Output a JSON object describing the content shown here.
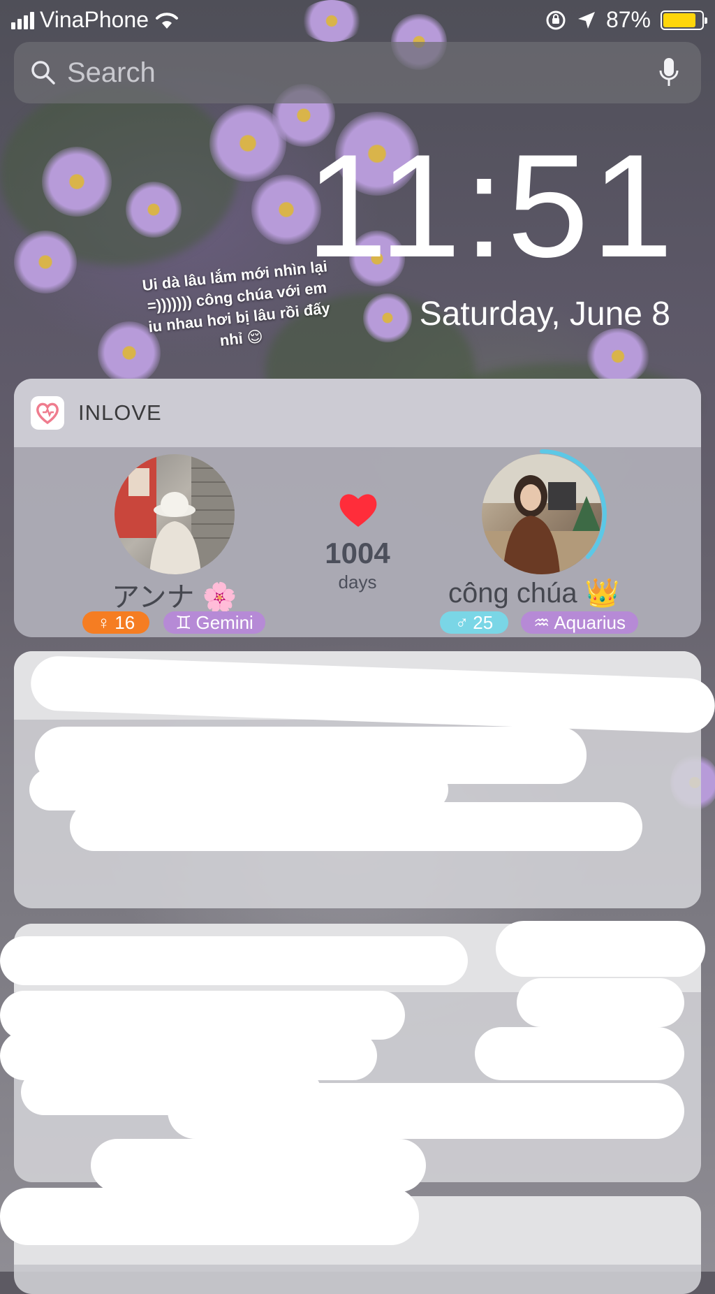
{
  "status_bar": {
    "carrier": "VinaPhone",
    "battery_percent": "87%",
    "battery_level": 0.87,
    "icons": [
      "signal-icon",
      "wifi-icon",
      "orientation-lock-icon",
      "location-arrow-icon",
      "battery-icon"
    ]
  },
  "search": {
    "placeholder": "Search"
  },
  "clock": {
    "time": "11:51",
    "date": "Saturday, June 8"
  },
  "sticker": {
    "lines": [
      "Ui dà lâu lắm mới nhìn lại",
      "=))))))) công chúa với em",
      "iu nhau hơi bị lâu rồi đấy",
      "nhỉ 😌"
    ]
  },
  "widget": {
    "app_name": "INLOVE",
    "days_count": "1004",
    "days_label": "days",
    "left_person": {
      "name": "アンナ 🌸",
      "age": "16",
      "gender_symbol": "♀",
      "zodiac": "Gemini",
      "zodiac_symbol": "♊︎",
      "age_color": "#f57d22"
    },
    "right_person": {
      "name": "công chúa 👑",
      "age": "25",
      "gender_symbol": "♂",
      "zodiac": "Aquarius",
      "zodiac_symbol": "♒︎",
      "age_color": "#7ad6e6"
    },
    "zodiac_color": "#b68ad6",
    "heart_color": "#ff2d3a"
  }
}
